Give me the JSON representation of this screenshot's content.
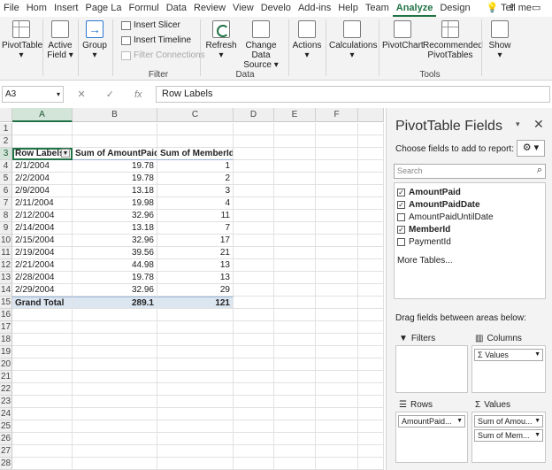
{
  "menu": {
    "tabs": [
      "File",
      "Home",
      "Insert",
      "Page Layout",
      "Formulas",
      "Data",
      "Review",
      "View",
      "Developer",
      "Add-ins",
      "Help",
      "Team",
      "Analyze",
      "Design"
    ],
    "tab_display": [
      "File",
      "Hom",
      "Insert",
      "Page La",
      "Formul",
      "Data",
      "Review",
      "View",
      "Develo",
      "Add-ins",
      "Help",
      "Team",
      "Analyze",
      "Design"
    ],
    "active": "Analyze",
    "tell_me": "Tell me"
  },
  "ribbon": {
    "pivottable": "PivotTable",
    "active_field": "Active",
    "active_field2": "Field",
    "group": "Group",
    "insert_slicer": "Insert Slicer",
    "insert_timeline": "Insert Timeline",
    "filter_connections": "Filter Connections",
    "filter_group": "Filter",
    "refresh": "Refresh",
    "change_data_source": "Change Data",
    "change_data_source2": "Source",
    "data_group": "Data",
    "actions": "Actions",
    "calculations": "Calculations",
    "pivotchart": "PivotChart",
    "recommended": "Recommended",
    "recommended2": "PivotTables",
    "tools_group": "Tools",
    "show": "Show"
  },
  "formula_bar": {
    "name_box": "A3",
    "formula": "Row Labels"
  },
  "sheet": {
    "columns": [
      "A",
      "B",
      "C",
      "D",
      "E",
      "F"
    ],
    "rows": [
      "1",
      "2",
      "3",
      "4",
      "5",
      "6",
      "7",
      "8",
      "9",
      "10",
      "11",
      "12",
      "13",
      "14",
      "15",
      "16",
      "17",
      "18",
      "19",
      "20",
      "21",
      "22",
      "23",
      "24",
      "25",
      "26",
      "27",
      "28"
    ],
    "headers": [
      "Row Labels",
      "Sum of AmountPaid",
      "Sum of MemberId"
    ],
    "data": [
      [
        "2/1/2004",
        "19.78",
        "1"
      ],
      [
        "2/2/2004",
        "19.78",
        "2"
      ],
      [
        "2/9/2004",
        "13.18",
        "3"
      ],
      [
        "2/11/2004",
        "19.98",
        "4"
      ],
      [
        "2/12/2004",
        "32.96",
        "11"
      ],
      [
        "2/14/2004",
        "13.18",
        "7"
      ],
      [
        "2/15/2004",
        "32.96",
        "17"
      ],
      [
        "2/19/2004",
        "39.56",
        "21"
      ],
      [
        "2/21/2004",
        "44.98",
        "13"
      ],
      [
        "2/28/2004",
        "19.78",
        "13"
      ],
      [
        "2/29/2004",
        "32.96",
        "29"
      ]
    ],
    "total": [
      "Grand Total",
      "289.1",
      "121"
    ]
  },
  "pane": {
    "title": "PivotTable Fields",
    "subtitle": "Choose fields to add to report:",
    "search_placeholder": "Search",
    "fields": [
      {
        "name": "AmountPaid",
        "checked": true
      },
      {
        "name": "AmountPaidDate",
        "checked": true
      },
      {
        "name": "AmountPaidUntilDate",
        "checked": false
      },
      {
        "name": "MemberId",
        "checked": true
      },
      {
        "name": "PaymentId",
        "checked": false
      }
    ],
    "more_tables": "More Tables...",
    "drag_hint": "Drag fields between areas below:",
    "filters": "Filters",
    "columns": "Columns",
    "columns_chip": "Values",
    "rows": "Rows",
    "rows_chip": "AmountPaid...",
    "values": "Values",
    "values_chips": [
      "Sum of Amou...",
      "Sum of Mem..."
    ]
  }
}
